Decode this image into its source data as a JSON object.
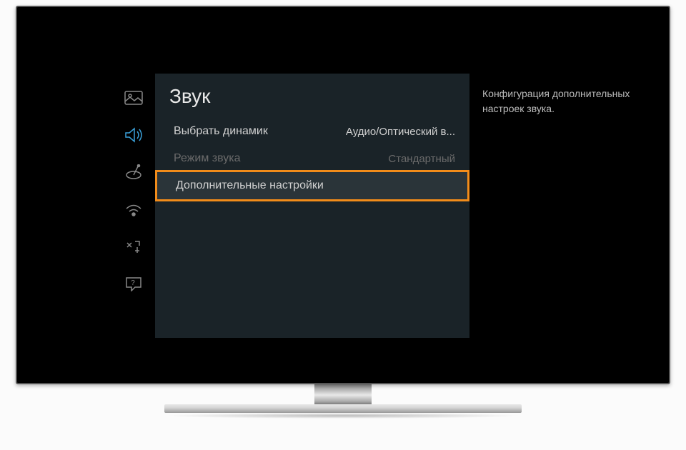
{
  "page_title": "Звук",
  "description": "Конфигурация дополнительных настроек звука.",
  "sidebar": {
    "items": [
      {
        "id": "picture-icon",
        "active": false
      },
      {
        "id": "sound-icon",
        "active": true
      },
      {
        "id": "broadcast-icon",
        "active": false
      },
      {
        "id": "network-icon",
        "active": false
      },
      {
        "id": "system-icon",
        "active": false
      },
      {
        "id": "support-icon",
        "active": false
      }
    ]
  },
  "menu": {
    "items": [
      {
        "label": "Выбрать динамик",
        "value": "Аудио/Оптический в...",
        "state": "normal"
      },
      {
        "label": "Режим звука",
        "value": "Стандартный",
        "state": "disabled"
      },
      {
        "label": "Дополнительные настройки",
        "value": "",
        "state": "highlighted"
      }
    ]
  }
}
